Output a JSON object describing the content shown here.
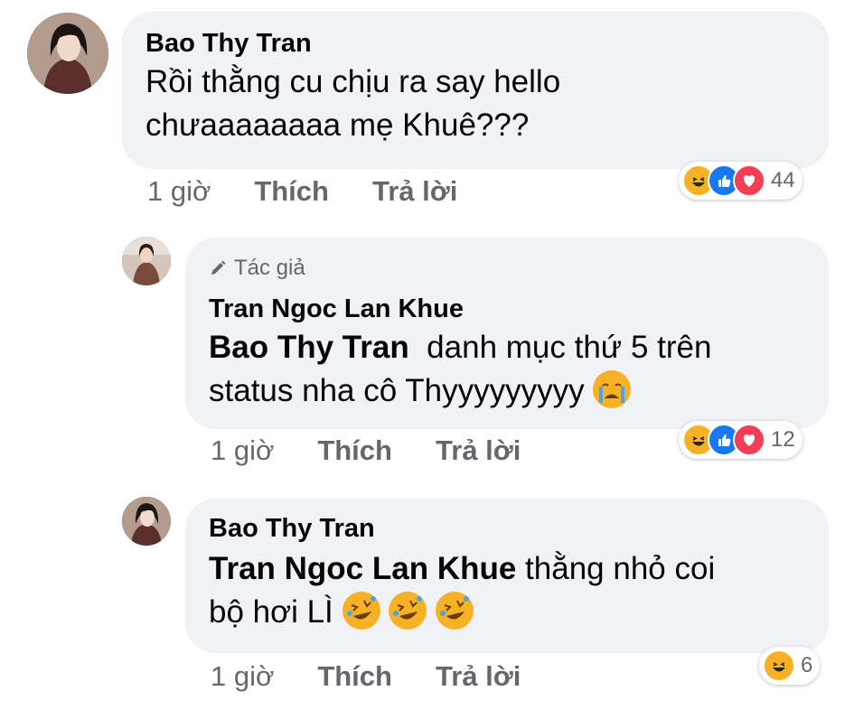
{
  "comments": [
    {
      "author": "Bao Thy Tran",
      "badge": "",
      "mention": "",
      "text_line1": "Rồi thằng cu chịu ra say hello",
      "text_line2": "chưaaaaaaaa mẹ Khuê???",
      "time": "1 giờ",
      "like": "Thích",
      "reply": "Trả lời",
      "reaction_count": "44",
      "reactions": [
        "haha-icon",
        "like-icon",
        "love-icon"
      ]
    },
    {
      "author": "Tran Ngoc Lan Khue",
      "badge": "Tác giả",
      "mention": "Bao Thy Tran",
      "text_line1": "danh mục thứ 5 trên",
      "text_line2": "status nha cô Thyyyyyyyyy",
      "time": "1 giờ",
      "like": "Thích",
      "reply": "Trả lời",
      "reaction_count": "12",
      "reactions": [
        "haha-icon",
        "like-icon",
        "love-icon"
      ]
    },
    {
      "author": "Bao Thy Tran",
      "badge": "",
      "mention": "Tran Ngoc Lan Khue",
      "text_line1": "thằng nhỏ coi",
      "text_line2": "bộ hơi LÌ",
      "time": "1 giờ",
      "like": "Thích",
      "reply": "Trả lời",
      "reaction_count": "6",
      "reactions": [
        "haha-icon"
      ]
    }
  ],
  "colors": {
    "bubble": "#f0f2f5",
    "secondary_text": "#65676b",
    "like_blue": "#1877f2",
    "love_red": "#f33e58",
    "haha_yellow": "#f7b125"
  }
}
